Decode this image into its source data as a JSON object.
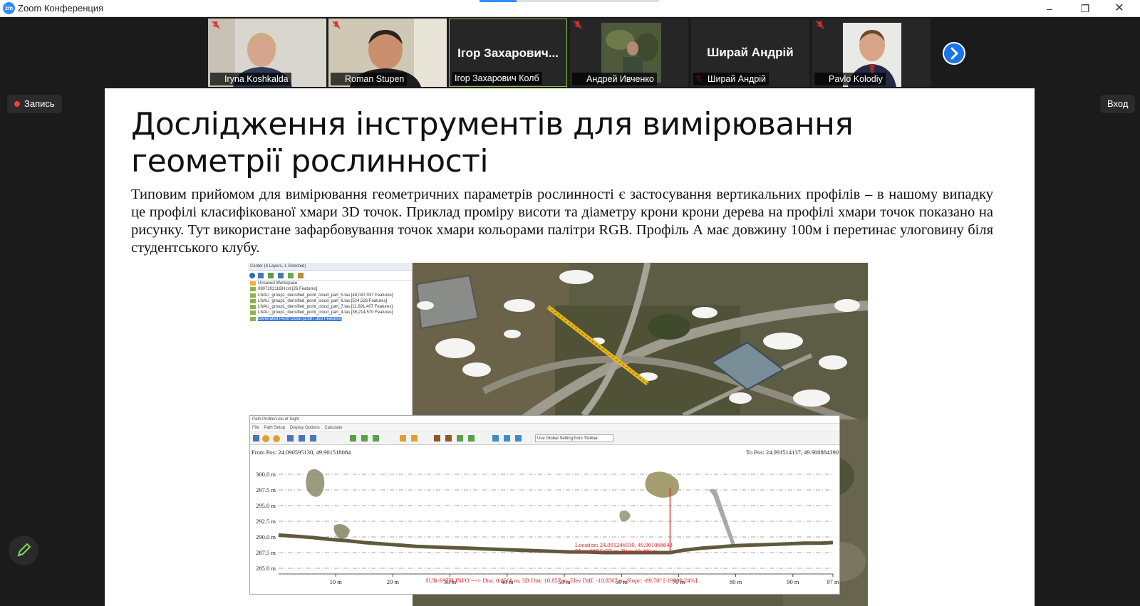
{
  "window": {
    "app_title": "Zoom Конференция"
  },
  "participants": [
    {
      "name": "Iryna Koshkalda",
      "video": true
    },
    {
      "name": "Roman Stupen",
      "video": true
    },
    {
      "name": "Ігор Захарович Колб",
      "display_name": "Ігор Захарович...",
      "video": false,
      "active": true
    },
    {
      "name": "Андрей Ивченко",
      "video": true
    },
    {
      "name": "Ширай Андрій",
      "display_name": "Ширай Андрій",
      "video": false
    },
    {
      "name": "Pavlo Kolodiy",
      "video": true
    }
  ],
  "recording_label": "Запись",
  "signin_label": "Вход",
  "slide": {
    "title": "Дослідження інструментів для вимірювання геометрії рослинності",
    "paragraph": "Типовим прийомом для вимірювання геометричних параметрів рослинності є застосування вертикальних профілів – в нашому випадку це профілі класифікованої хмари 3D точок. Приклад проміру висоти та діаметру крони крони дерева на профілі хмари точок показано на рисунку. Тут використане зафарбовування точок хмари кольорами палітри RGB. Профіль А має довжину 100м і перетинає улоговину біля студентського клубу."
  },
  "layers_panel": {
    "title": "Center (6 Layers, 1 Selected)",
    "items": [
      "Unsaved Workspace",
      "08072021LBH.txt [26 Features]",
      "LNAU_group1_densified_point_cloud_part_5.las [48,047,037 Features]",
      "LNAU_group1_densified_point_cloud_part_6.las [524,526 Features]",
      "LNAU_group1_densified_point_cloud_part_7.las [11,691,407 Features]",
      "LNAU_group1_densified_point_cloud_part_4.las [36,214,570 Features]",
      "Generated Point Cloud [3,887,383 Features]"
    ]
  },
  "profile_window": {
    "title": "Path Profile/Line of Sight",
    "menu": [
      "File",
      "Path Setup",
      "Display Options",
      "Calculate"
    ],
    "toolbar_setting": "Use Global Setting from Toolbar",
    "from_pos": "From Pos: 24.090595130, 49.901518084",
    "to_pos": "To Pos: 24.091514137, 49.900884390",
    "location_lines": [
      "Location: 24.091246930, 49.901068643",
      "Elev: 287.5477 m, Dist: 68.496 m"
    ],
    "subpath_info": "SUB-PATH INFO ==> Dist: 0.0568 m, 3D Dist: 10.857 m, Elev Diff: -10.8567 m, Slope: -89.70° [-19099.24%]"
  },
  "chart_data": {
    "type": "line",
    "title": "",
    "xlabel": "",
    "ylabel": "",
    "xlim": [
      0,
      97
    ],
    "ylim": [
      285,
      300
    ],
    "x_ticks": [
      "10 m",
      "20 m",
      "30 m",
      "40 m",
      "50 m",
      "60 m",
      "70 m",
      "80 m",
      "90 m",
      "97 m"
    ],
    "x_tick_values": [
      10,
      20,
      30,
      40,
      50,
      60,
      70,
      80,
      90,
      97
    ],
    "y_ticks": [
      "300.0 m",
      "297.5 m",
      "295.0 m",
      "292.5 m",
      "290.0 m",
      "287.5 m",
      "285.0 m"
    ],
    "y_tick_values": [
      300,
      297.5,
      295,
      292.5,
      290,
      287.5,
      285
    ],
    "series": [
      {
        "x": [
          0,
          3,
          6,
          9,
          12,
          15,
          18,
          21,
          24,
          27,
          30,
          33,
          36,
          39,
          42,
          45,
          48,
          51,
          54,
          57,
          60,
          63,
          66,
          68.5,
          71,
          74,
          77,
          80,
          83,
          86,
          89,
          92,
          95,
          97
        ],
        "values": [
          290.3,
          290.1,
          289.9,
          289.6,
          289.4,
          289.1,
          288.9,
          288.7,
          288.5,
          288.4,
          288.3,
          288.2,
          288.1,
          288.0,
          287.9,
          287.8,
          287.7,
          287.6,
          287.6,
          287.5,
          287.5,
          287.5,
          287.5,
          287.5,
          287.9,
          288.2,
          288.4,
          288.6,
          288.7,
          288.8,
          288.9,
          289.0,
          289.0,
          289.1
        ]
      }
    ],
    "measurement": {
      "x": 68.5,
      "y_top": 297.9,
      "y_bottom": 287.5
    }
  }
}
